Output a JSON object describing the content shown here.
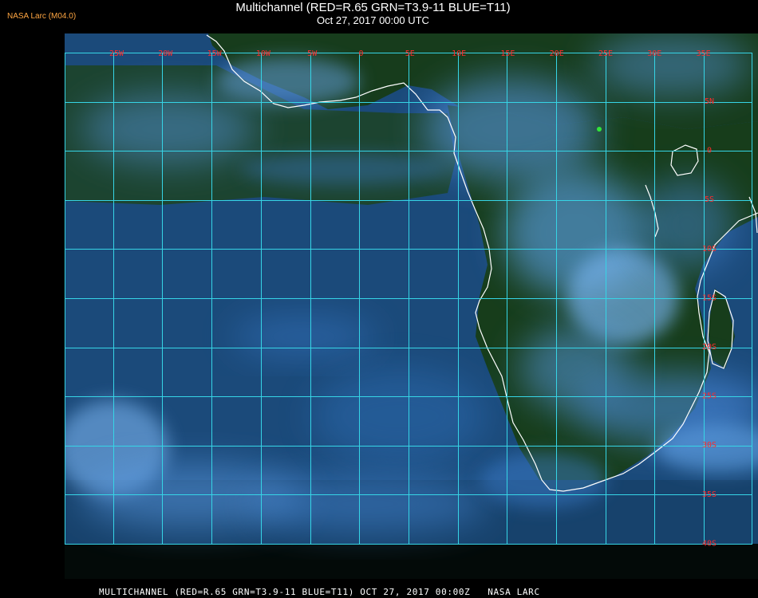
{
  "header": {
    "credit": "NASA Larc (M04.0)",
    "title_line1": "Multichannel (RED=R.65 GRN=T3.9-11 BLUE=T11)",
    "title_line2": "Oct 27, 2017 00:00 UTC"
  },
  "footer": {
    "caption": "MULTICHANNEL (RED=R.65 GRN=T3.9-11 BLUE=T11) OCT 27, 2017 00:00Z   NASA LARC"
  },
  "map": {
    "longitude_labels": [
      "25W",
      "20W",
      "15W",
      "10W",
      "5W",
      "0",
      "5E",
      "10E",
      "15E",
      "20E",
      "25E",
      "30E",
      "35E"
    ],
    "latitude_labels": [
      "5N",
      "0",
      "5S",
      "10S",
      "15S",
      "20S",
      "25S",
      "30S",
      "35S",
      "40S"
    ],
    "colors": {
      "grid": "#36d5e6",
      "label": "#ff2b2b",
      "coast": "#ffffff",
      "ocean": "#1c4e7e",
      "land": "#173d1b",
      "cloud": "#63aaf5",
      "marker": "#31e63a"
    }
  }
}
